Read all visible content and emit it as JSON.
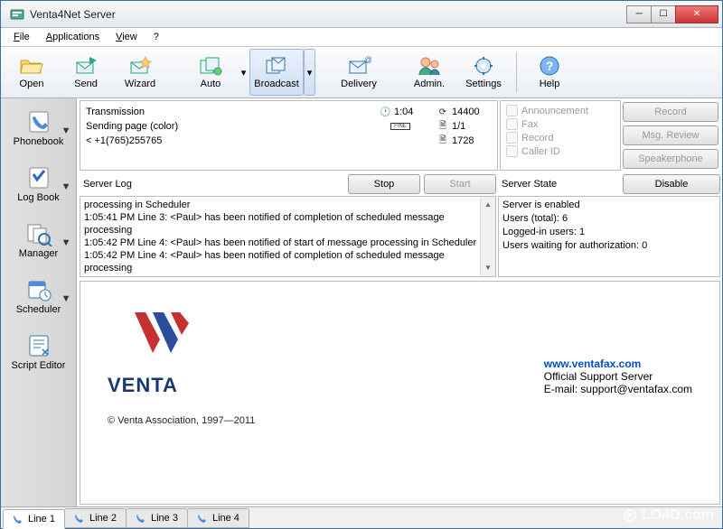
{
  "title": "Venta4Net Server",
  "menu": {
    "file": "File",
    "applications": "Applications",
    "view": "View",
    "help": "?"
  },
  "toolbar": {
    "open": "Open",
    "send": "Send",
    "wizard": "Wizard",
    "auto": "Auto",
    "broadcast": "Broadcast",
    "delivery": "Delivery",
    "admin": "Admin.",
    "settings": "Settings",
    "help": "Help"
  },
  "sidebar": {
    "phonebook": "Phonebook",
    "logbook": "Log Book",
    "manager": "Manager",
    "scheduler": "Scheduler",
    "scripteditor": "Script Editor"
  },
  "transmission": {
    "title": "Transmission",
    "sending": "Sending page (color)",
    "number": "<  +1(765)255765",
    "time": "1:04",
    "speed": "14400",
    "quality": "FINE",
    "pages": "1/1",
    "bytes": "1728"
  },
  "options": {
    "announcement": "Announcement",
    "fax": "Fax",
    "record": "Record",
    "callerid": "Caller ID"
  },
  "buttons": {
    "record": "Record",
    "msgreview": "Msg. Review",
    "speakerphone": "Speakerphone",
    "disable": "Disable",
    "stop": "Stop",
    "start": "Start"
  },
  "log": {
    "label": "Server Log",
    "lines": [
      "processing in Scheduler",
      "1:05:41 PM Line 3: <Paul> has been notified of completion of scheduled message processing",
      "1:05:42 PM Line 4: <Paul> has been notified of start of message processing in Scheduler",
      "1:05:42 PM Line 4: <Paul> has been notified of completion of scheduled message processing"
    ]
  },
  "state": {
    "label": "Server State",
    "lines": [
      "Server is enabled",
      "Users (total): 6",
      "Logged-in users: 1",
      "Users waiting for authorization: 0"
    ]
  },
  "preview": {
    "brand": "VENTA",
    "copyright": "© Venta Association, 1997—2011",
    "url": "www.ventafax.com",
    "support1": "Official Support Server",
    "support2": "E-mail: support@ventafax.com"
  },
  "tabs": {
    "l1": "Line 1",
    "l2": "Line 2",
    "l3": "Line 3",
    "l4": "Line 4"
  },
  "watermark": "LO4D.com"
}
